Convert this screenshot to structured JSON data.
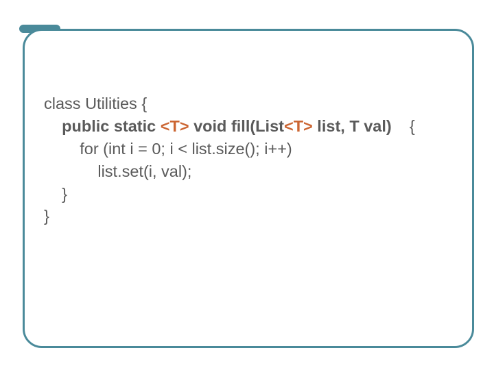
{
  "code": {
    "line1_a": "class Utilities {",
    "line2_lead": "    ",
    "line2_a": "public static ",
    "line2_b": "<T>",
    "line2_c": " void fill(List",
    "line2_d": "<T>",
    "line2_e": " list, T val)    ",
    "line2_f": "{",
    "line3": "        for (int i = 0; i < list.size(); i++)",
    "line4": "            list.set(i, val);",
    "line5": "    }",
    "line6": "}"
  }
}
